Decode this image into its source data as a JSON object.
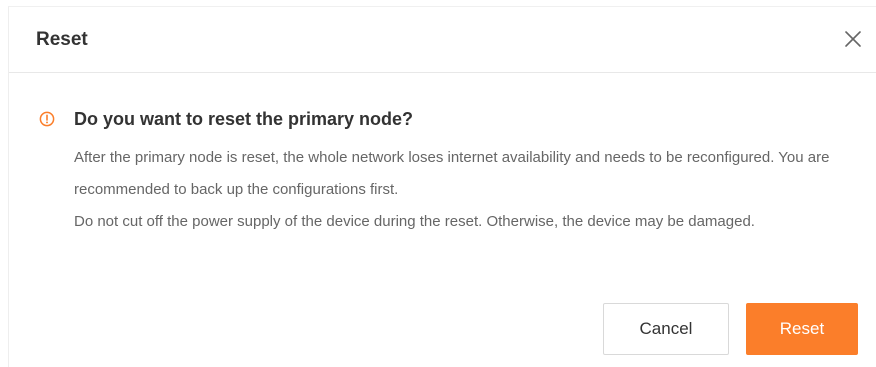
{
  "dialog": {
    "title": "Reset",
    "close_icon": "close-icon",
    "warning_icon": "warning-circle-icon",
    "question": "Do you want to reset the primary node?",
    "paragraphs": [
      "After the primary node is reset, the whole network loses internet availability and needs to be reconfigured. You are recommended to back up the configurations first.",
      "Do not cut off the power supply of the device during the reset. Otherwise, the device may be damaged."
    ],
    "cancel_label": "Cancel",
    "reset_label": "Reset"
  },
  "colors": {
    "accent": "#fb7e2a",
    "title_text": "#333333",
    "body_text": "#666666",
    "divider": "#e8e8e8"
  }
}
